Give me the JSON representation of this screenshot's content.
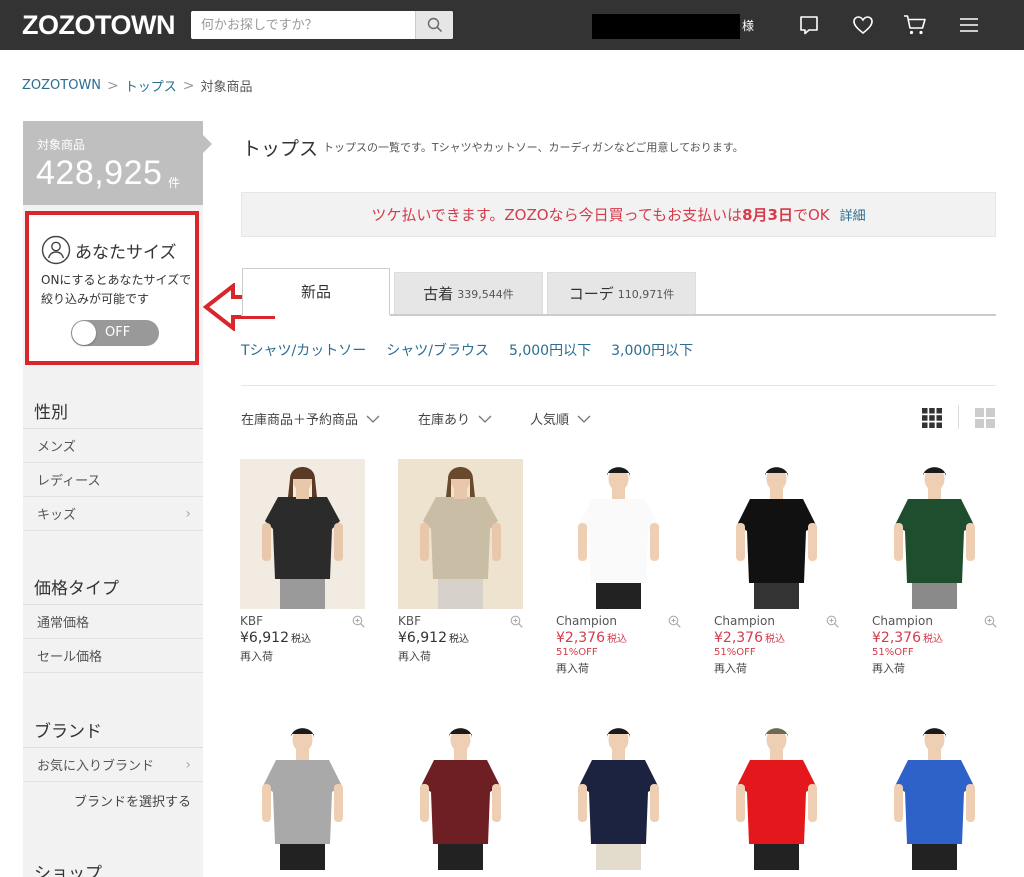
{
  "header": {
    "logo": "ZOZOTOWN",
    "search_placeholder": "何かお探しですか？",
    "honorific": "様"
  },
  "breadcrumb": [
    "ZOZOTOWN",
    "トップス",
    "対象商品"
  ],
  "sidebar": {
    "count_label": "対象商品",
    "count": "428,925",
    "count_unit": "件",
    "size_title": "あなたサイズ",
    "size_desc": "ONにするとあなたサイズで絞り込みが可能です",
    "toggle_label": "OFF",
    "sections": [
      {
        "title": "性別",
        "items": [
          {
            "label": "メンズ"
          },
          {
            "label": "レディース"
          },
          {
            "label": "キッズ",
            "chev": "›"
          }
        ]
      },
      {
        "title": "価格タイプ",
        "items": [
          {
            "label": "通常価格"
          },
          {
            "label": "セール価格"
          }
        ]
      },
      {
        "title": "ブランド",
        "items": [
          {
            "label": "お気に入りブランド",
            "chev": "›"
          }
        ],
        "link": "ブランドを選択する"
      },
      {
        "title": "ショップ",
        "items": []
      }
    ]
  },
  "main": {
    "title": "トップス",
    "description": "トップスの一覧です。Tシャツやカットソー、カーディガンなどご用意しております。",
    "promo": {
      "text_before": "ツケ払いできます。ZOZOなら今日買ってもお支払いは",
      "date": "8月3日",
      "text_after": "でOK",
      "link": "詳細"
    },
    "tabs": [
      {
        "label": "新品",
        "count": ""
      },
      {
        "label": "古着",
        "count": "339,544件"
      },
      {
        "label": "コーデ",
        "count": "110,971件"
      }
    ],
    "subcategories": [
      "Tシャツ/カットソー",
      "シャツ/ブラウス",
      "5,000円以下",
      "3,000円以下"
    ],
    "filters": [
      "在庫商品＋予約商品",
      "在庫あり",
      "人気順"
    ],
    "products": [
      {
        "brand": "KBF",
        "price": "¥6,912",
        "tax": "税込",
        "discount": "",
        "note": "再入荷",
        "sale": false,
        "bg": "#f1ebe2",
        "shirt": "#2b2b2b",
        "skin": "#e8c7aa",
        "hair": "#5a3a24",
        "pants": "#9a9a9a",
        "female": true
      },
      {
        "brand": "KBF",
        "price": "¥6,912",
        "tax": "税込",
        "discount": "",
        "note": "再入荷",
        "sale": false,
        "bg": "#ede3cf",
        "shirt": "#c9bda6",
        "skin": "#e8c7aa",
        "hair": "#6a4a2c",
        "pants": "#d6d2cb",
        "female": true
      },
      {
        "brand": "Champion",
        "price": "¥2,376",
        "tax": "税込",
        "discount": "51%OFF",
        "note": "再入荷",
        "sale": true,
        "bg": "#ffffff",
        "shirt": "#fafafa",
        "skin": "#efcfb4",
        "hair": "#1a1a1a",
        "pants": "#222222",
        "female": false
      },
      {
        "brand": "Champion",
        "price": "¥2,376",
        "tax": "税込",
        "discount": "51%OFF",
        "note": "再入荷",
        "sale": true,
        "bg": "#ffffff",
        "shirt": "#111111",
        "skin": "#efcfb4",
        "hair": "#1a1a1a",
        "pants": "#333333",
        "female": false
      },
      {
        "brand": "Champion",
        "price": "¥2,376",
        "tax": "税込",
        "discount": "51%OFF",
        "note": "再入荷",
        "sale": true,
        "bg": "#ffffff",
        "shirt": "#1f4e2f",
        "skin": "#efcfb4",
        "hair": "#1a1a1a",
        "pants": "#8a8a8a",
        "female": false
      },
      {
        "brand": "",
        "price": "",
        "tax": "",
        "discount": "",
        "note": "",
        "sale": false,
        "bg": "#ffffff",
        "shirt": "#a9a9a9",
        "skin": "#efcfb4",
        "hair": "#1a1a1a",
        "pants": "#222222",
        "female": false
      },
      {
        "brand": "",
        "price": "",
        "tax": "",
        "discount": "",
        "note": "",
        "sale": false,
        "bg": "#ffffff",
        "shirt": "#6e1f24",
        "skin": "#efcfb4",
        "hair": "#1a1a1a",
        "pants": "#222222",
        "female": false
      },
      {
        "brand": "",
        "price": "",
        "tax": "",
        "discount": "",
        "note": "",
        "sale": false,
        "bg": "#ffffff",
        "shirt": "#1c2340",
        "skin": "#efcfb4",
        "hair": "#1a1a1a",
        "pants": "#e3dccd",
        "female": false
      },
      {
        "brand": "",
        "price": "",
        "tax": "",
        "discount": "",
        "note": "",
        "sale": false,
        "bg": "#ffffff",
        "shirt": "#e3171c",
        "skin": "#efcfb4",
        "hair": "#6b6b55",
        "pants": "#222222",
        "female": false
      },
      {
        "brand": "",
        "price": "",
        "tax": "",
        "discount": "",
        "note": "",
        "sale": false,
        "bg": "#ffffff",
        "shirt": "#2e62c9",
        "skin": "#efcfb4",
        "hair": "#1a1a1a",
        "pants": "#222222",
        "female": false
      }
    ]
  },
  "colors": {
    "header_bg": "#333333",
    "link": "#2b6e8f",
    "sale": "#d53b4b",
    "annotation": "#d8262b"
  }
}
